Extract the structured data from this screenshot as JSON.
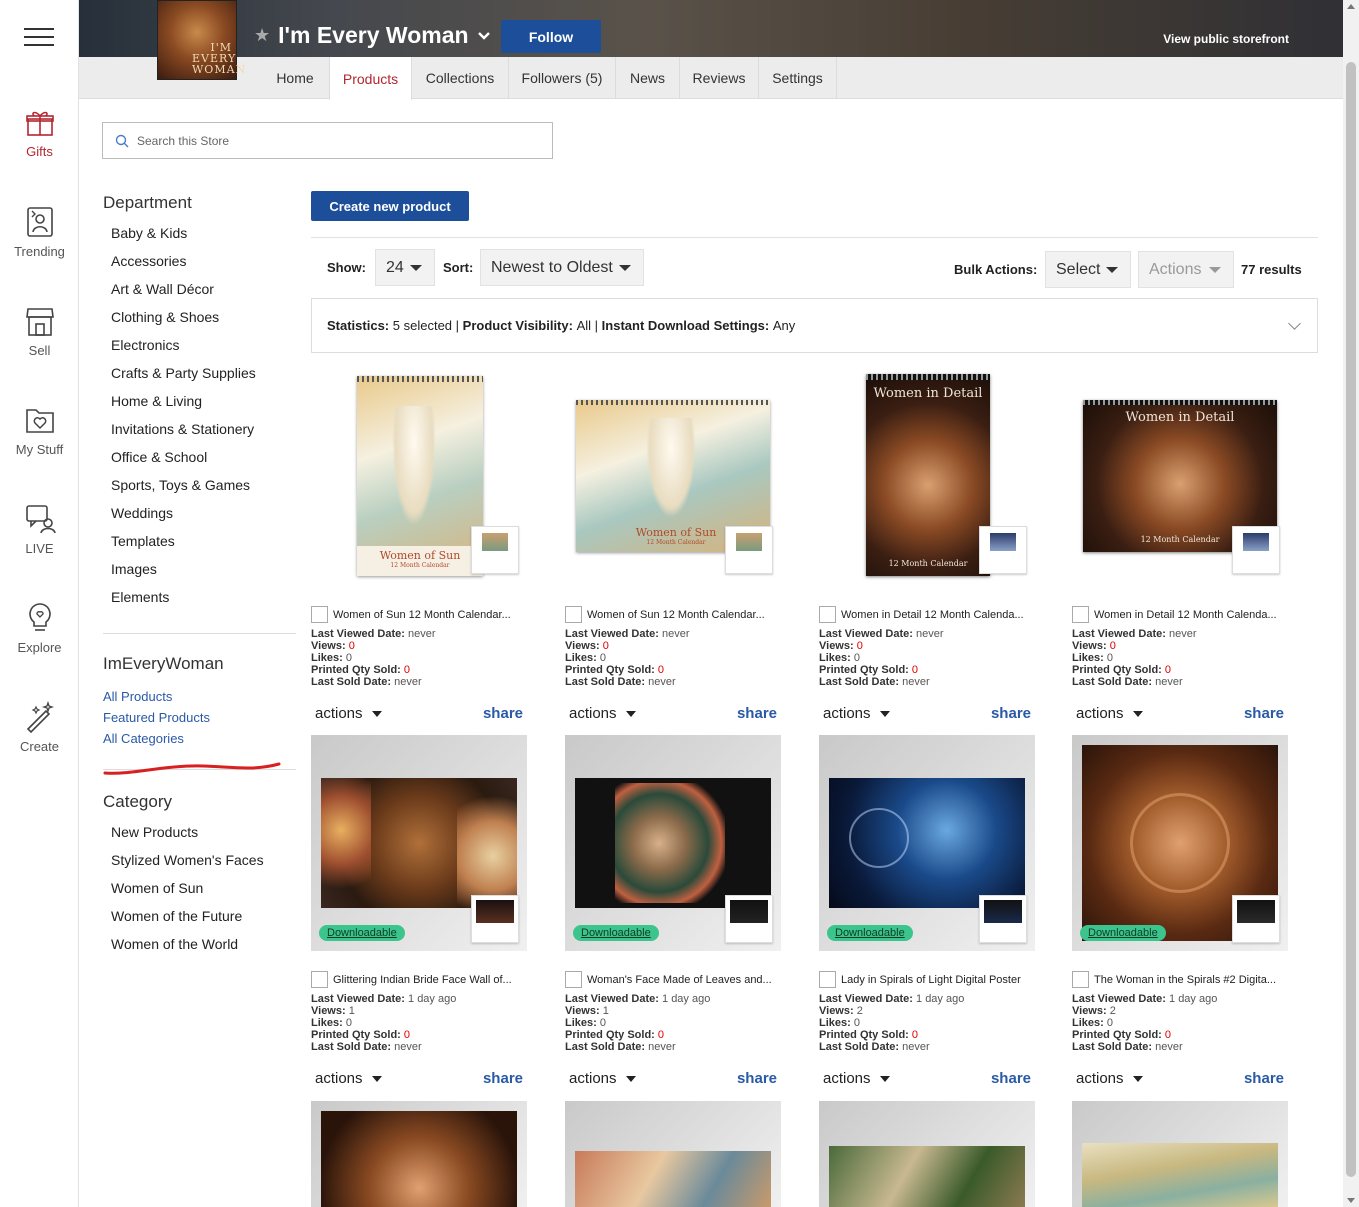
{
  "rail": {
    "items": [
      {
        "label": "Gifts",
        "icon": "gift-icon"
      },
      {
        "label": "Trending",
        "icon": "trending-icon"
      },
      {
        "label": "Sell",
        "icon": "storefront-icon"
      },
      {
        "label": "My Stuff",
        "icon": "folder-heart-icon"
      },
      {
        "label": "LIVE",
        "icon": "live-chat-icon"
      },
      {
        "label": "Explore",
        "icon": "lightbulb-icon"
      },
      {
        "label": "Create",
        "icon": "magic-wand-icon"
      }
    ]
  },
  "store": {
    "avatar_text": "I'M EVERY WOMAN",
    "title": "I'm Every Woman",
    "follow_label": "Follow",
    "view_public_label": "View public storefront"
  },
  "tabs": [
    {
      "label": "Home"
    },
    {
      "label": "Products"
    },
    {
      "label": "Collections"
    },
    {
      "label": "Followers (5)"
    },
    {
      "label": "News"
    },
    {
      "label": "Reviews"
    },
    {
      "label": "Settings"
    }
  ],
  "search": {
    "placeholder": "Search this Store"
  },
  "sidebar": {
    "department_heading": "Department",
    "departments": [
      "Baby & Kids",
      "Accessories",
      "Art & Wall Décor",
      "Clothing & Shoes",
      "Electronics",
      "Crafts & Party Supplies",
      "Home & Living",
      "Invitations & Stationery",
      "Office & School",
      "Sports, Toys & Games",
      "Weddings",
      "Templates",
      "Images",
      "Elements"
    ],
    "store_heading": "ImEveryWoman",
    "store_links": [
      "All Products",
      "Featured Products",
      "All Categories"
    ],
    "category_heading": "Category",
    "categories": [
      "New Products",
      "Stylized Women's Faces",
      "Women of Sun",
      "Women of the Future",
      "Women of the World"
    ]
  },
  "toolbar": {
    "create_label": "Create new product",
    "show_label": "Show:",
    "show_value": "24",
    "sort_label": "Sort:",
    "sort_value": "Newest to Oldest",
    "bulk_label": "Bulk Actions:",
    "bulk_select": "Select",
    "bulk_actions": "Actions",
    "results_count": "77",
    "results_word": "results"
  },
  "stats": {
    "stat_label": "Statistics:",
    "stat_value": "5 selected",
    "vis_label": "Product Visibility:",
    "vis_value": "All",
    "dl_label": "Instant Download Settings:",
    "dl_value": "Any",
    "sep": "|"
  },
  "card_labels": {
    "last_viewed": "Last Viewed Date:",
    "views": "Views:",
    "likes": "Likes:",
    "printed": "Printed Qty Sold:",
    "last_sold": "Last Sold Date:",
    "actions": "actions",
    "share": "share",
    "downloadable": "Downloadable"
  },
  "products": [
    {
      "title": "Women of Sun 12 Month Calendar...",
      "last_viewed": "never",
      "views": "0",
      "likes": "0",
      "printed": "0",
      "last_sold": "never",
      "image_text": "Women of Sun",
      "image_sub": "12 Month Calendar"
    },
    {
      "title": "Women of Sun 12 Month Calendar...",
      "last_viewed": "never",
      "views": "0",
      "likes": "0",
      "printed": "0",
      "last_sold": "never",
      "image_text": "Women of Sun",
      "image_sub": "12 Month Calendar"
    },
    {
      "title": "Women in Detail 12 Month Calenda...",
      "last_viewed": "never",
      "views": "0",
      "likes": "0",
      "printed": "0",
      "last_sold": "never",
      "image_text": "Women in Detail",
      "image_sub": "12 Month Calendar"
    },
    {
      "title": "Women in Detail 12 Month Calenda...",
      "last_viewed": "never",
      "views": "0",
      "likes": "0",
      "printed": "0",
      "last_sold": "never",
      "image_text": "Women in Detail",
      "image_sub": "12 Month Calendar"
    },
    {
      "title": "Glittering Indian Bride Face Wall of...",
      "last_viewed": "1 day ago",
      "views": "1",
      "likes": "0",
      "printed": "0",
      "last_sold": "never"
    },
    {
      "title": "Woman's Face Made of Leaves and...",
      "last_viewed": "1 day ago",
      "views": "1",
      "likes": "0",
      "printed": "0",
      "last_sold": "never"
    },
    {
      "title": "Lady in Spirals of Light Digital Poster",
      "last_viewed": "1 day ago",
      "views": "2",
      "likes": "0",
      "printed": "0",
      "last_sold": "never"
    },
    {
      "title": "The Woman in the Spirals #2 Digita...",
      "last_viewed": "1 day ago",
      "views": "2",
      "likes": "0",
      "printed": "0",
      "last_sold": "never"
    }
  ],
  "colors": {
    "accent": "#b42631",
    "brand_blue": "#1d4e99",
    "badge_green": "#3cc48d"
  }
}
